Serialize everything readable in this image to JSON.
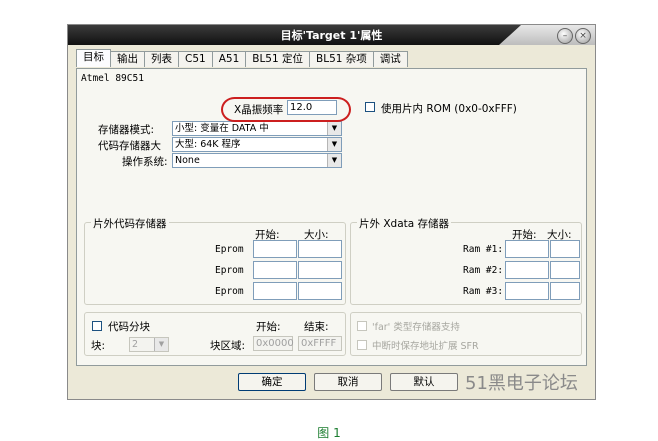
{
  "window": {
    "title": "目标'Target 1'属性"
  },
  "tabs": [
    "目标",
    "输出",
    "列表",
    "C51",
    "A51",
    "BL51 定位",
    "BL51 杂项",
    "调试"
  ],
  "device": "Atmel 89C51",
  "xtal": {
    "label": "X晶振频率",
    "value": "12.0"
  },
  "onchip_rom": {
    "label": "使用片内 ROM (0x0-0xFFF)",
    "checked": false
  },
  "memory_model": {
    "label": "存储器模式:",
    "value": "小型: 变量在 DATA 中"
  },
  "code_rom_size": {
    "label": "代码存储器大",
    "value": "大型: 64K 程序"
  },
  "os": {
    "label": "操作系统:",
    "value": "None"
  },
  "offchip_code": {
    "title": "片外代码存储器",
    "col_start": "开始:",
    "col_size": "大小:",
    "rows": [
      "Eprom",
      "Eprom",
      "Eprom"
    ]
  },
  "offchip_xdata": {
    "title": "片外 Xdata 存储器",
    "col_start": "开始:",
    "col_size": "大小:",
    "rows": [
      "Ram #1:",
      "Ram #2:",
      "Ram #3:"
    ]
  },
  "code_banking": {
    "checkbox_label": "代码分块",
    "col_start": "开始:",
    "col_end": "结束:",
    "banks_label": "块:",
    "banks_value": "2",
    "range_label": "块区域:",
    "range_start": "0x0000",
    "range_end": "0xFFFF"
  },
  "far_memory": "'far' 类型存储器支持",
  "save_sfr": "中断时保存地址扩展 SFR",
  "buttons": {
    "ok": "确定",
    "cancel": "取消",
    "defaults": "默认"
  },
  "watermark": "51黑电子论坛",
  "caption": "图 1",
  "colors": {
    "highlight_oval": "#cc1f1f",
    "caption": "#1a7c2e",
    "titlebar": "#1e1e1e"
  }
}
